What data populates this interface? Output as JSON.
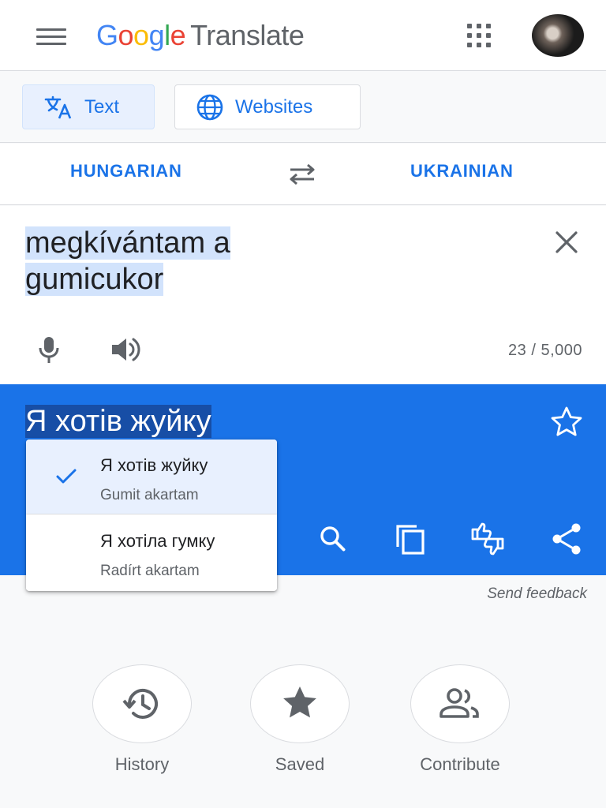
{
  "header": {
    "logo_letters": [
      "G",
      "o",
      "o",
      "g",
      "l",
      "e"
    ],
    "product": "Translate",
    "brand_colors": {
      "blue": "#4285f4",
      "red": "#ea4335",
      "yellow": "#fbbc05",
      "green": "#34a853"
    },
    "icons": {
      "menu": "menu-icon",
      "apps": "apps-grid-icon",
      "avatar": "account-avatar"
    }
  },
  "modes": {
    "text": {
      "label": "Text",
      "icon": "translate-icon",
      "active": true
    },
    "websites": {
      "label": "Websites",
      "icon": "globe-icon",
      "active": false
    }
  },
  "languages": {
    "source": "HUNGARIAN",
    "target": "UKRAINIAN",
    "swap_icon": "swap-arrows-icon"
  },
  "source": {
    "text_line1": "megkívántam a",
    "text_line2": "gumicukor",
    "char_count": "23 / 5,000",
    "icons": [
      "close-icon",
      "microphone-icon",
      "speaker-icon"
    ]
  },
  "target": {
    "text": "Я хотів жуйку",
    "icons": [
      "star-outline-icon",
      "search-icon",
      "copy-icon",
      "rate-translation-icon",
      "share-icon"
    ]
  },
  "alternatives": [
    {
      "main": "Я хотів жуйку",
      "back_translation": "Gumit akartam",
      "selected": true
    },
    {
      "main": "Я хотіла гумку",
      "back_translation": "Radírt akartam",
      "selected": false
    }
  ],
  "feedback_link": "Send feedback",
  "shortcuts": [
    {
      "label": "History",
      "icon": "history-icon"
    },
    {
      "label": "Saved",
      "icon": "star-icon"
    },
    {
      "label": "Contribute",
      "icon": "people-icon"
    }
  ],
  "colors": {
    "accent": "#1a73e8",
    "selection": "#d2e3fc",
    "target_bg": "#1a73e8",
    "target_selection": "#174ea6"
  }
}
